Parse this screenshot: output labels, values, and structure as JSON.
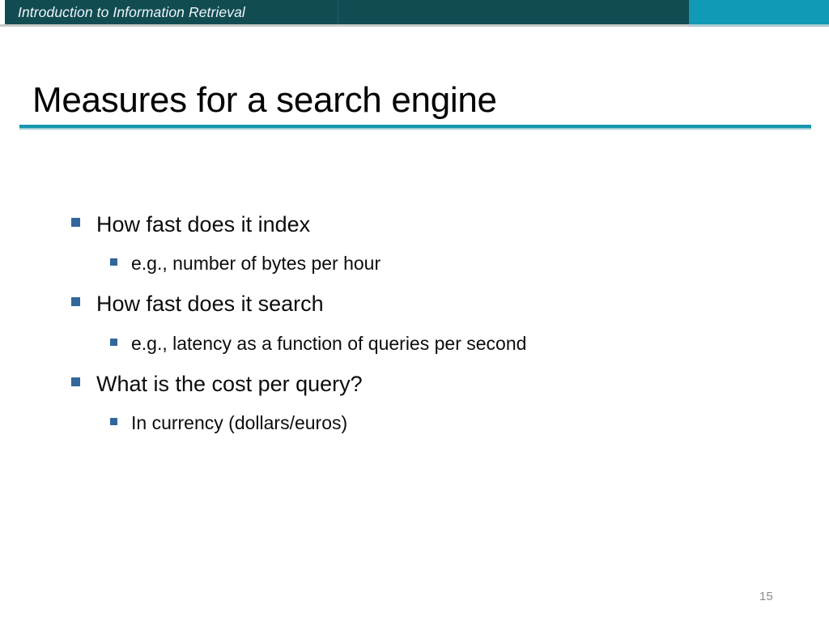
{
  "header": {
    "course_title": "Introduction to Information Retrieval",
    "dark_color": "#124c53",
    "accent_color": "#109ab5"
  },
  "slide": {
    "title": "Measures for a search engine",
    "rule_color": "#1596ad",
    "page_number": "15",
    "bullet_color": "#31679a"
  },
  "bullets": [
    {
      "level": 1,
      "text": "How fast does it index"
    },
    {
      "level": 2,
      "text": "e.g., number of bytes per hour"
    },
    {
      "level": 1,
      "text": "How fast does it search"
    },
    {
      "level": 2,
      "text": "e.g., latency as a function of queries per second"
    },
    {
      "level": 1,
      "text": "What is the cost per query?"
    },
    {
      "level": 2,
      "text": "In currency (dollars/euros)"
    }
  ]
}
